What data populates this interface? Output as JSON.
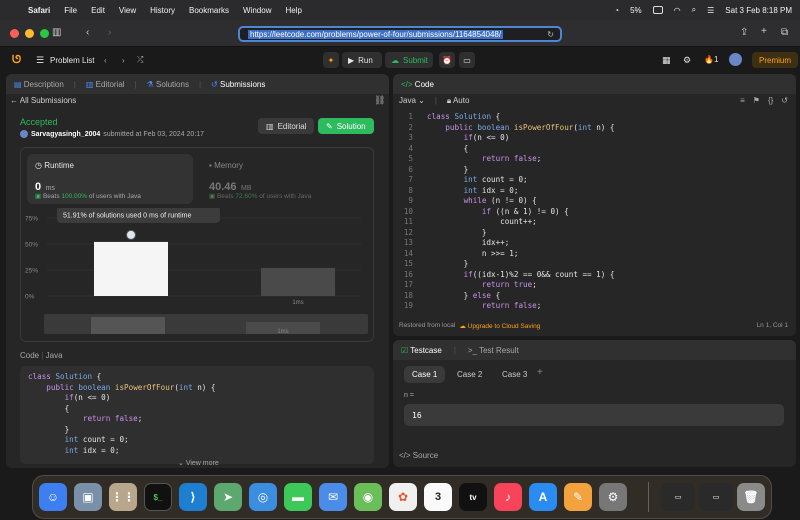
{
  "menubar": {
    "app": "Safari",
    "items": [
      "File",
      "Edit",
      "View",
      "History",
      "Bookmarks",
      "Window",
      "Help"
    ],
    "battery": "5%",
    "datetime": "Sat 3 Feb  8:18 PM"
  },
  "safari": {
    "url": "https://leetcode.com/problems/power-of-four/submissions/1164854048/"
  },
  "lc": {
    "problem_list": "Problem List",
    "run": "Run",
    "submit": "Submit",
    "streak": "1",
    "premium": "Premium"
  },
  "left": {
    "tabs": [
      "Description",
      "Editorial",
      "Solutions",
      "Submissions"
    ],
    "back": "All Submissions",
    "status": "Accepted",
    "user": "Sarvagyasingh_2004",
    "submitted": "submitted at Feb 03, 2024 20:17",
    "editorial_btn": "Editorial",
    "solution_btn": "Solution",
    "runtime": {
      "label": "Runtime",
      "value": "0",
      "unit": "ms",
      "beats_prefix": "Beats",
      "beats_pct": "100.00%",
      "beats_suffix": "of users with Java"
    },
    "memory": {
      "label": "Memory",
      "value": "40.46",
      "unit": "MB",
      "beats_prefix": "Beats",
      "beats_pct": "72.60%",
      "beats_suffix": "of users with Java"
    },
    "tooltip": "51.91% of solutions used 0 ms of runtime",
    "code_header": "Code",
    "code_lang": "Java",
    "view_more": "View more",
    "code": [
      "class Solution {",
      "    public boolean isPowerOfFour(int n) {",
      "        if(n <= 0)",
      "        {",
      "            return false;",
      "        }",
      "        int count = 0;",
      "        int idx = 0;"
    ]
  },
  "chart_data": {
    "type": "bar",
    "categories": [
      "0ms",
      "1ms"
    ],
    "values": [
      52,
      27
    ],
    "yticks": [
      "75%",
      "50%",
      "25%",
      "0%"
    ],
    "xlabels": [
      "",
      "1ms"
    ],
    "ylim": [
      0,
      75
    ],
    "mini_label": "1ms"
  },
  "editor": {
    "title": "Code",
    "lang": "Java",
    "mode": "Auto",
    "lines": [
      "class Solution {",
      "    public boolean isPowerOfFour(int n) {",
      "        if(n <= 0)",
      "        {",
      "            return false;",
      "        }",
      "        int count = 0;",
      "        int idx = 0;",
      "        while (n != 0) {",
      "            if ((n & 1) != 0) {",
      "                count++;",
      "            }",
      "            idx++;",
      "            n >>= 1;",
      "        }",
      "        if((idx-1)%2 == 0&& count == 1) {",
      "            return true;",
      "        } else {",
      "            return false;"
    ],
    "line_numbers": [
      "1",
      "2",
      "3",
      "4",
      "5",
      "6",
      "7",
      "8",
      "9",
      "10",
      "11",
      "12",
      "13",
      "14",
      "15",
      "16",
      "17",
      "18",
      "19"
    ],
    "footer_left": "Restored from local",
    "footer_upgrade": "Upgrade to Cloud Saving",
    "footer_right": "Ln 1, Col 1"
  },
  "testcase": {
    "tab_testcase": "Testcase",
    "tab_result": "Test Result",
    "cases": [
      "Case 1",
      "Case 2",
      "Case 3"
    ],
    "param": "n =",
    "value": "16",
    "source": "Source"
  },
  "colors": {
    "accent_green": "#2cbb5d",
    "accent_orange": "#ffa116",
    "url_border": "#4e86d6"
  }
}
